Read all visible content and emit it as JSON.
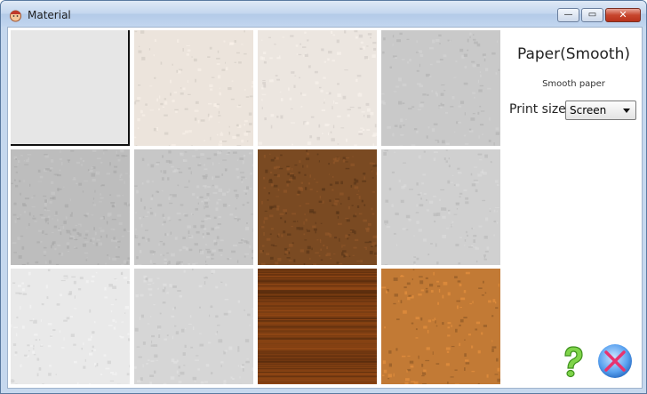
{
  "window": {
    "title": "Material"
  },
  "caption": {
    "minimize": "—",
    "maximize": "▭",
    "close": "✕"
  },
  "materials": [
    {
      "id": "blank",
      "color": "#e6e6e6"
    },
    {
      "id": "cream-1",
      "color": "#ece4dc"
    },
    {
      "id": "cream-2",
      "color": "#ece6e0"
    },
    {
      "id": "grey-crinkle",
      "color": "#c9c9c9"
    },
    {
      "id": "canvas-fine",
      "color": "#bdbdbd"
    },
    {
      "id": "canvas-coarse",
      "color": "#c7c7c7"
    },
    {
      "id": "burlap-brown",
      "color": "#7a4a22"
    },
    {
      "id": "stucco-grey",
      "color": "#d0d0d0"
    },
    {
      "id": "plaster-white",
      "color": "#e9e9e9"
    },
    {
      "id": "stucco-light",
      "color": "#d6d6d6"
    },
    {
      "id": "wood-dark",
      "color": "#7c3d12"
    },
    {
      "id": "cork-orange",
      "color": "#c27a35"
    }
  ],
  "selected_index": 0,
  "detail": {
    "title": "Paper(Smooth)",
    "description": "Smooth paper",
    "print_size_label": "Print size",
    "print_size_value": "Screen"
  },
  "buttons": {
    "help_icon": "question-mark-icon",
    "close_icon": "x-close-icon"
  }
}
